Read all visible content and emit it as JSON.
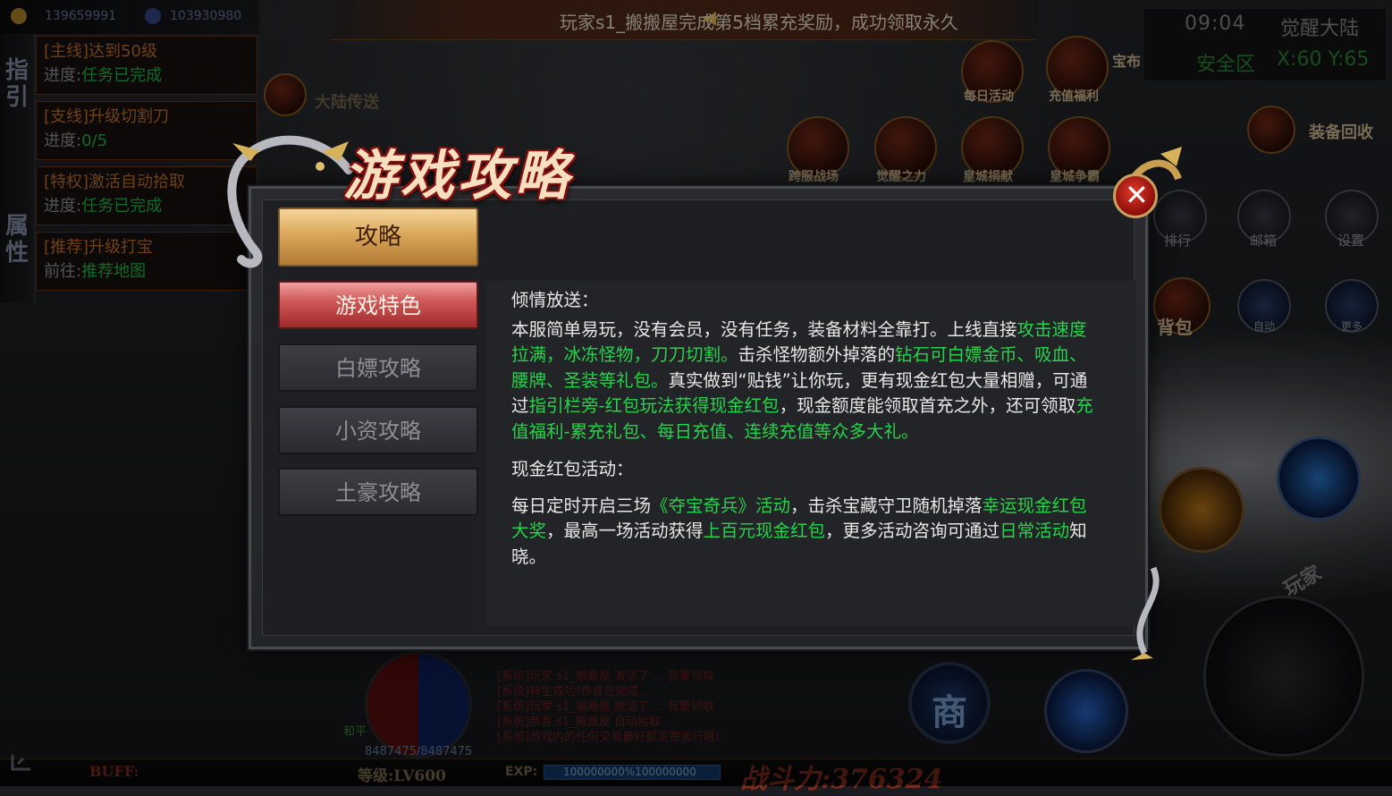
{
  "currency": {
    "gold": "139659991",
    "ingot": "103930980"
  },
  "marquee": {
    "text": "玩家s1_搬搬屋完成第5档累充奖励，成功领取永久"
  },
  "hud": {
    "time": "09:04",
    "map": "觉醒大陆",
    "zone": "安全区",
    "coord": "X:60 Y:65"
  },
  "quest_tabs": [
    "指引",
    "属性"
  ],
  "quests": [
    {
      "title": "[主线]达到50级",
      "prog_label": "进度:",
      "prog_value": "任务已完成"
    },
    {
      "title": "[支线]升级切割刀",
      "prog_label": "进度:",
      "prog_value": "0/5"
    },
    {
      "title": "[特权]激活自动拾取",
      "prog_label": "进度:",
      "prog_value": "任务已完成"
    },
    {
      "title": "[推荐]升级打宝",
      "prog_label": "前往:",
      "prog_value": "推荐地图"
    }
  ],
  "map_buttons": {
    "teleport": "大陆传送",
    "daily": "每日活动",
    "recharge": "充值福利",
    "treasure": "宝布",
    "cross": "跨服战场",
    "awaken": "觉醒之力",
    "donate": "皇城捐献",
    "siege": "皇城争霸",
    "recycle": "装备回收",
    "rank": "排行",
    "mail": "邮箱",
    "settings": "设置",
    "bag": "背包",
    "auto": "自动",
    "more": "更多",
    "player": "玩家",
    "shop": "商"
  },
  "dialog": {
    "title": "游戏攻略",
    "close_symbol": "✕",
    "tabs": {
      "main": "攻略",
      "selected": "游戏特色",
      "items": [
        "白嫖攻略",
        "小资攻略",
        "土豪攻略"
      ]
    },
    "content": {
      "s1_title": "倾情放送：",
      "s1": [
        "本服简单易玩，没有会员，没有任务，装备材料全靠打。上线直接",
        "攻击速度拉满，冰冻怪物，刀刀切割。",
        "击杀怪物额外掉落的",
        "钻石可白嫖金币、吸血、腰牌、圣装等礼包。",
        "真实做到“贴钱”让你玩，更有现金红包大量相赠，可通过",
        "指引栏旁-红包玩法获得现金红包",
        "，现金额度能领取首充之外，还可领取",
        "充值福利-累充礼包、每日充值、连续充值等众多大礼。"
      ],
      "s2_title": "现金红包活动：",
      "s2": [
        "每日定时开启三场",
        "《夺宝奇兵》活动",
        "，击杀宝藏守卫随机掉落",
        "幸运现金红包大奖",
        "，最高一场活动获得",
        "上百元现金红包",
        "，更多活动咨询可通过",
        "日常活动",
        "知晓。"
      ]
    }
  },
  "chat": [
    "[系统]玩家 s1_搬搬屋 激活了 ... 我要领取",
    "[系统]转生成功!恭喜您完成 ...",
    "[系统]玩家 s1_搬搬屋 激活了 ... 我要领取",
    "[系统]恭喜 s1_搬搬屋 自动拾取",
    "[系统]游戏内的任何交易最好都走寄卖行哦!"
  ],
  "bottom": {
    "buff": "BUFF:",
    "level": "等级:LV600",
    "exp_label": "EXP:",
    "exp_text": "100000000%100000000",
    "power": "战斗力:376324",
    "hp": "8487475/8487475",
    "mode": "和平"
  }
}
